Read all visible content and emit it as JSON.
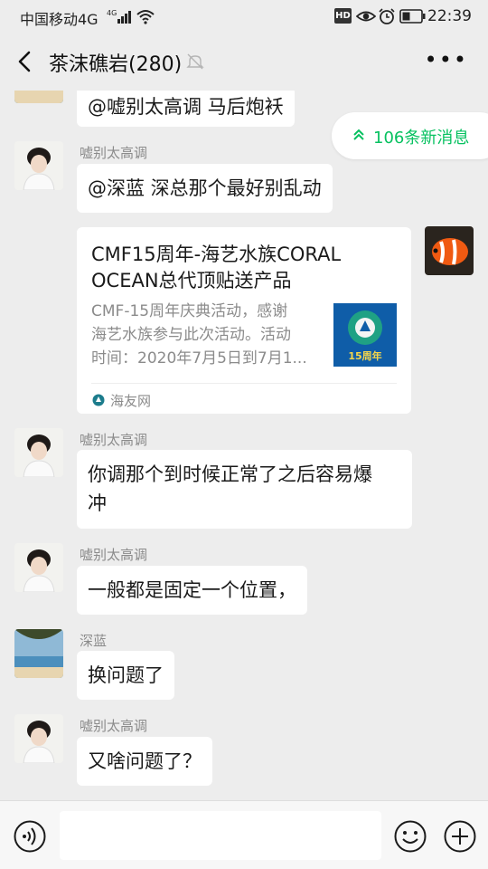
{
  "status": {
    "carrier": "中国移动4G",
    "network": "4G",
    "time": "22:39",
    "hd_badge": "HD"
  },
  "header": {
    "title": "茶沫礁岩(280)"
  },
  "new_messages": {
    "label": "106条新消息"
  },
  "messages": [
    {
      "sender": "",
      "text": "@嘘别太高调  马后炮袄",
      "avatar": "beach-photo"
    },
    {
      "sender": "嘘别太高调",
      "text": "@深蓝  深总那个最好别乱动",
      "avatar": "boy-photo"
    },
    {
      "sender": "嘘别太高调",
      "text_line1": "你调那个到时候正常了之后容易爆",
      "text_line2": "冲",
      "avatar": "boy-photo"
    },
    {
      "sender": "嘘别太高调",
      "text": "一般都是固定一个位置，",
      "avatar": "boy-photo"
    },
    {
      "sender": "深蓝",
      "text": "换问题了",
      "avatar": "beach-photo"
    },
    {
      "sender": "嘘别太高调",
      "text": "又啥问题了？",
      "avatar": "boy-photo"
    }
  ],
  "shared_card": {
    "title_line1": "CMF15周年-海艺水族CORAL",
    "title_line2": "OCEAN总代顶贴送产品",
    "desc_line1": "CMF-15周年庆典活动，感谢",
    "desc_line2": "海艺水族参与此次活动。活动",
    "desc_line3": "时间：2020年7月5日到7月1...",
    "source": "海友网",
    "thumb_text": "15周年",
    "avatar": "clownfish-photo"
  },
  "input": {
    "value": ""
  },
  "colors": {
    "background": "#ededed",
    "accent_green": "#07c160",
    "bubble": "#ffffff",
    "meta_gray": "#8b8b8b"
  }
}
